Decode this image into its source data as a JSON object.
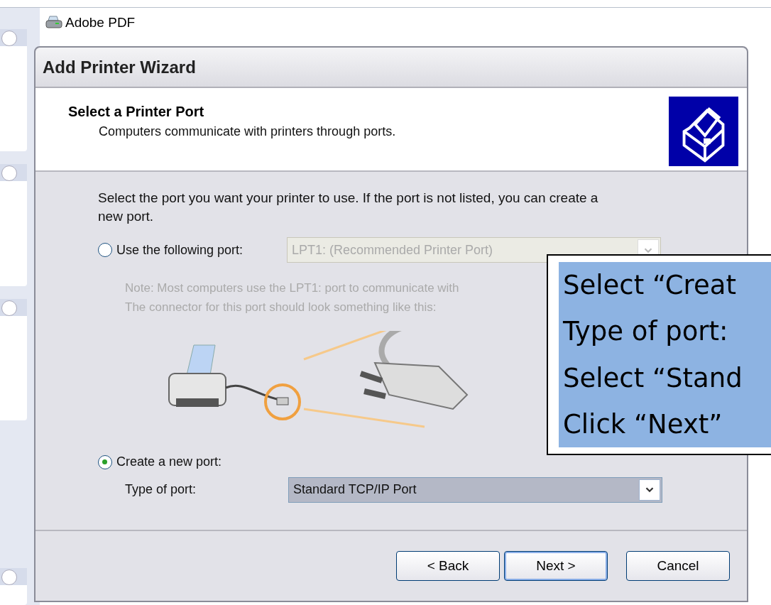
{
  "background": {
    "printers": [
      {
        "name": "Adobe PDF"
      }
    ]
  },
  "window": {
    "title": "Add Printer Wizard"
  },
  "header": {
    "title": "Select a Printer Port",
    "subtitle": "Computers communicate with printers through ports."
  },
  "instructions": "Select the port you want your printer to use.  If the port is not listed, you can create a new port.",
  "existing_port": {
    "label": "Use the following port:",
    "selected": false,
    "combo": {
      "value": "LPT1: (Recommended Printer Port)",
      "disabled": true
    },
    "note": [
      "Note: Most computers use the LPT1: port to communicate with",
      "The connector for this port should look something like this:"
    ]
  },
  "new_port": {
    "label": "Create a new port:",
    "selected": true,
    "type_label": "Type of port:",
    "combo": {
      "value": "Standard TCP/IP Port",
      "disabled": false
    }
  },
  "buttons": [
    {
      "label": "< Back",
      "default": false
    },
    {
      "label": "Next >",
      "default": true
    },
    {
      "label": "Cancel",
      "default": false
    }
  ],
  "callout": {
    "lines": [
      "Select “Creat",
      "Type of port:",
      "Select “Stand",
      "Click “Next”"
    ]
  }
}
